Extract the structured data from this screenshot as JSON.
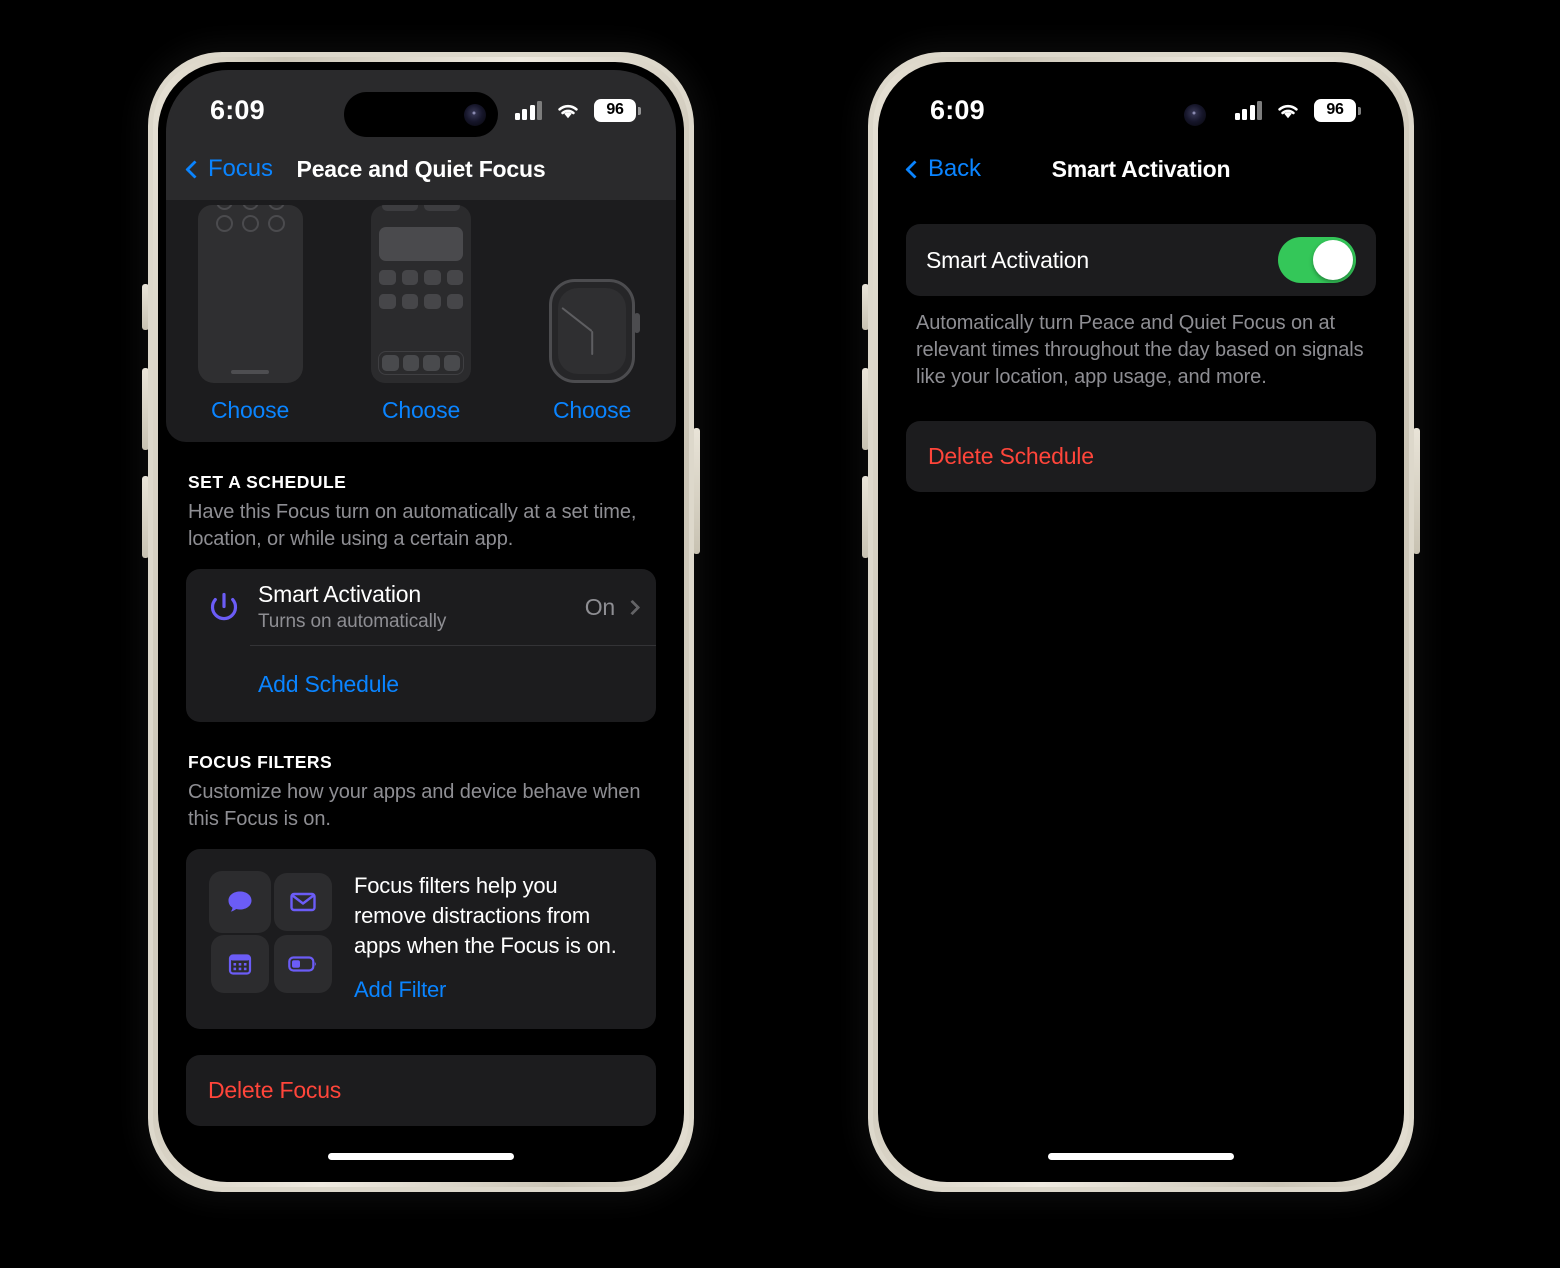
{
  "status_bar": {
    "time": "6:09",
    "battery_level": "96",
    "cellular_icon": "cellular-bars-icon",
    "wifi_icon": "wifi-icon",
    "battery_icon": "battery-icon"
  },
  "left_phone": {
    "nav": {
      "back_label": "Focus",
      "title": "Peace and Quiet Focus"
    },
    "customize_section": {
      "previews": [
        {
          "name": "lock-screen-preview",
          "choose_label": "Choose"
        },
        {
          "name": "home-screen-preview",
          "choose_label": "Choose"
        },
        {
          "name": "watch-face-preview",
          "choose_label": "Choose"
        }
      ]
    },
    "schedule_section": {
      "header": "SET A SCHEDULE",
      "description": "Have this Focus turn on automatically at a set time, location, or while using a certain app.",
      "smart_activation": {
        "icon": "power-icon",
        "icon_color": "#6b5cf6",
        "title": "Smart Activation",
        "subtitle": "Turns on automatically",
        "value": "On",
        "chevron": "chevron-right-icon"
      },
      "add_schedule_label": "Add Schedule"
    },
    "filters_section": {
      "header": "FOCUS FILTERS",
      "description": "Customize how your apps and device behave when this Focus is on.",
      "promo_text": "Focus filters help you remove distractions from apps when the Focus is on.",
      "add_filter_label": "Add Filter",
      "filter_icons": [
        "messages-bubble-icon",
        "mail-envelope-icon",
        "calendar-icon",
        "low-power-battery-icon"
      ]
    },
    "delete_focus_label": "Delete Focus"
  },
  "right_phone": {
    "nav": {
      "back_label": "Back",
      "title": "Smart Activation"
    },
    "toggle_row": {
      "label": "Smart Activation",
      "state": "on",
      "on_color": "#34c759"
    },
    "description": "Automatically turn Peace and Quiet Focus on at relevant times throughout the day based on signals like your location, app usage, and more.",
    "delete_schedule_label": "Delete Schedule"
  },
  "colors": {
    "accent_blue": "#0a84ff",
    "destructive_red": "#ff453a",
    "toggle_green": "#34c759",
    "filter_purple": "#6b5cf6",
    "group_bg": "#1c1c1e",
    "secondary_text": "#8e8e93"
  }
}
